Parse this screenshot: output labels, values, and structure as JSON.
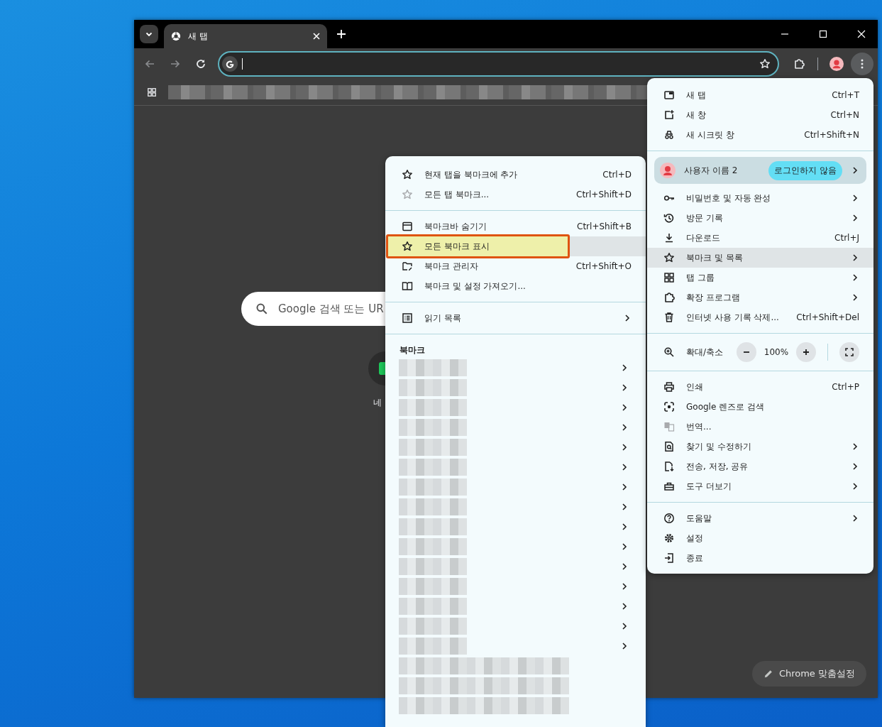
{
  "tab": {
    "title": "새 탭"
  },
  "new_tab_page": {
    "search_placeholder": "Google 검색 또는 UR",
    "shortcut_label": "네"
  },
  "customize_button": {
    "label": "Chrome 맞춤설정"
  },
  "main_menu": {
    "sections": [
      [
        {
          "kind": "item",
          "label": "새 탭",
          "shortcut": "Ctrl+T",
          "submenu": false,
          "highlighted": false,
          "disabled": false
        },
        {
          "kind": "item",
          "label": "새 창",
          "shortcut": "Ctrl+N",
          "submenu": false,
          "highlighted": false,
          "disabled": false
        },
        {
          "kind": "item",
          "label": "새 시크릿 창",
          "shortcut": "Ctrl+Shift+N",
          "submenu": false,
          "highlighted": false,
          "disabled": false
        }
      ],
      [
        {
          "kind": "profile",
          "label": "사용자 이름 2",
          "badge": "로그인하지 않음",
          "submenu": true,
          "highlighted": false,
          "disabled": false
        },
        {
          "kind": "item",
          "label": "비밀번호 및 자동 완성",
          "submenu": true,
          "highlighted": false,
          "disabled": false
        },
        {
          "kind": "item",
          "label": "방문 기록",
          "submenu": true,
          "highlighted": false,
          "disabled": false
        },
        {
          "kind": "item",
          "label": "다운로드",
          "shortcut": "Ctrl+J",
          "submenu": false,
          "highlighted": false,
          "disabled": false
        },
        {
          "kind": "item",
          "label": "북마크 및 목록",
          "submenu": true,
          "highlighted": true,
          "disabled": false
        },
        {
          "kind": "item",
          "label": "탭 그룹",
          "submenu": true,
          "highlighted": false,
          "disabled": false
        },
        {
          "kind": "item",
          "label": "확장 프로그램",
          "submenu": true,
          "highlighted": false,
          "disabled": false
        },
        {
          "kind": "item",
          "label": "인터넷 사용 기록 삭제...",
          "shortcut": "Ctrl+Shift+Del",
          "submenu": false,
          "highlighted": false,
          "disabled": false
        }
      ],
      [
        {
          "kind": "zoom",
          "label": "확대/축소",
          "value": "100%",
          "submenu": false,
          "highlighted": false,
          "disabled": false
        }
      ],
      [
        {
          "kind": "item",
          "label": "인쇄",
          "shortcut": "Ctrl+P",
          "submenu": false,
          "highlighted": false,
          "disabled": false
        },
        {
          "kind": "item",
          "label": "Google 렌즈로 검색",
          "submenu": false,
          "highlighted": false,
          "disabled": false
        },
        {
          "kind": "item",
          "label": "번역...",
          "submenu": false,
          "highlighted": false,
          "disabled": true
        },
        {
          "kind": "item",
          "label": "찾기 및 수정하기",
          "submenu": true,
          "highlighted": false,
          "disabled": false
        },
        {
          "kind": "item",
          "label": "전송, 저장, 공유",
          "submenu": true,
          "highlighted": false,
          "disabled": false
        },
        {
          "kind": "item",
          "label": "도구 더보기",
          "submenu": true,
          "highlighted": false,
          "disabled": false
        }
      ],
      [
        {
          "kind": "item",
          "label": "도움말",
          "submenu": true,
          "highlighted": false,
          "disabled": false
        },
        {
          "kind": "item",
          "label": "설정",
          "submenu": false,
          "highlighted": false,
          "disabled": false
        },
        {
          "kind": "item",
          "label": "종료",
          "submenu": false,
          "highlighted": false,
          "disabled": false
        }
      ]
    ]
  },
  "bookmarks_menu": {
    "sections": [
      [
        {
          "kind": "item",
          "label": "현재 탭을 북마크에 추가",
          "shortcut": "Ctrl+D",
          "submenu": false,
          "highlighted": false,
          "disabled": false,
          "annotated": false
        },
        {
          "kind": "item",
          "label": "모든 탭 북마크...",
          "shortcut": "Ctrl+Shift+D",
          "submenu": false,
          "highlighted": false,
          "disabled": true,
          "annotated": false
        }
      ],
      [
        {
          "kind": "item",
          "label": "북마크바 숨기기",
          "shortcut": "Ctrl+Shift+B",
          "submenu": false,
          "highlighted": false,
          "disabled": false,
          "annotated": false
        },
        {
          "kind": "item",
          "label": "모든 북마크 표시",
          "submenu": false,
          "highlighted": true,
          "disabled": false,
          "annotated": true
        },
        {
          "kind": "item",
          "label": "북마크 관리자",
          "shortcut": "Ctrl+Shift+O",
          "submenu": false,
          "highlighted": false,
          "disabled": false,
          "annotated": false
        },
        {
          "kind": "item",
          "label": "북마크 및 설정 가져오기...",
          "submenu": false,
          "highlighted": false,
          "disabled": false,
          "annotated": false
        }
      ],
      [
        {
          "kind": "item",
          "label": "읽기 목록",
          "submenu": true,
          "highlighted": false,
          "disabled": false,
          "annotated": false
        }
      ]
    ],
    "heading": "북마크",
    "bookmarks": [
      {
        "kind": "folder"
      },
      {
        "kind": "folder"
      },
      {
        "kind": "folder"
      },
      {
        "kind": "folder"
      },
      {
        "kind": "folder"
      },
      {
        "kind": "folder"
      },
      {
        "kind": "folder"
      },
      {
        "kind": "folder"
      },
      {
        "kind": "folder"
      },
      {
        "kind": "folder"
      },
      {
        "kind": "folder"
      },
      {
        "kind": "folder"
      },
      {
        "kind": "folder"
      },
      {
        "kind": "folder"
      },
      {
        "kind": "folder"
      },
      {
        "kind": "link"
      },
      {
        "kind": "link"
      },
      {
        "kind": "link"
      }
    ]
  }
}
